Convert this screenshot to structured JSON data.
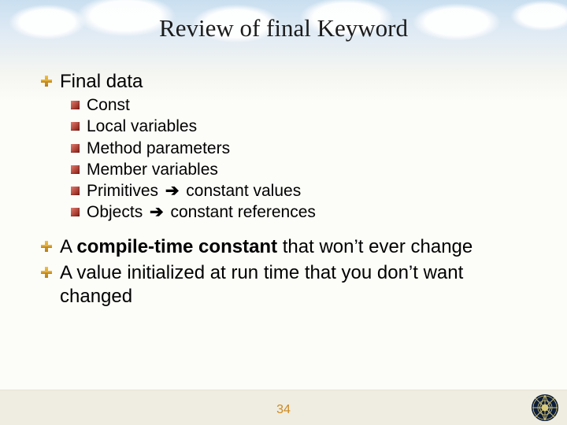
{
  "title": "Review of final Keyword",
  "items": [
    {
      "level": 1,
      "text": "Final data"
    },
    {
      "level": 2,
      "text": "Const"
    },
    {
      "level": 2,
      "text": "Local variables"
    },
    {
      "level": 2,
      "text": "Method parameters"
    },
    {
      "level": 2,
      "text": "Member variables"
    },
    {
      "level": 2,
      "pre": "Primitives ",
      "arrow": "➔",
      "post": " constant values"
    },
    {
      "level": 2,
      "pre": "Objects ",
      "arrow": "➔",
      "post": " constant references"
    },
    {
      "level": 1,
      "gap": true,
      "pre": "A ",
      "bold": "compile-time constant",
      "post": " that won’t ever change"
    },
    {
      "level": 1,
      "text": "A value initialized at run time that you don’t want changed"
    }
  ],
  "page": "34"
}
